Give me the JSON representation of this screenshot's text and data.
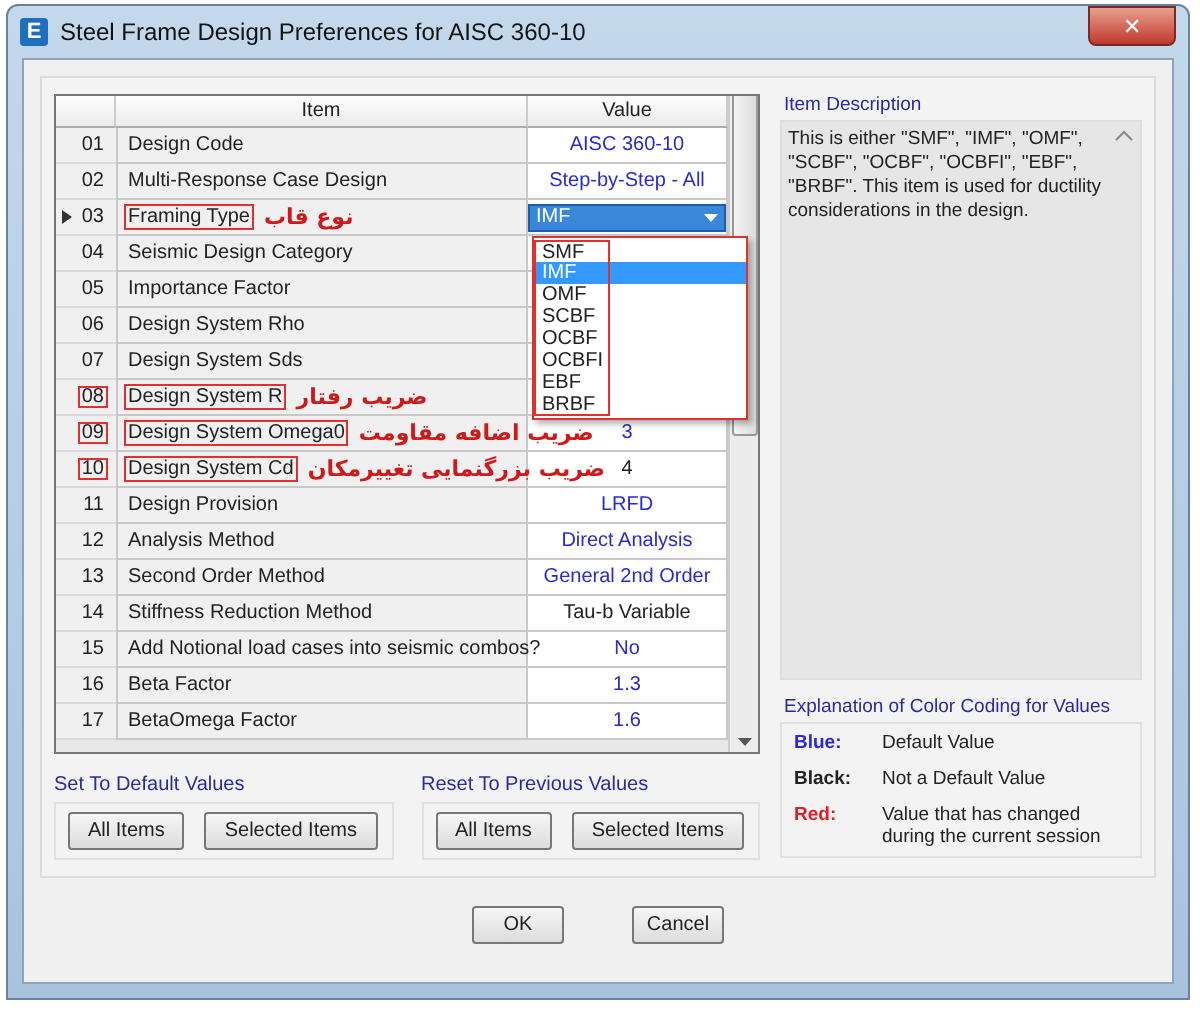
{
  "window": {
    "title": "Steel Frame Design Preferences for AISC 360-10",
    "icon_letter": "E",
    "close_label": "✕"
  },
  "grid": {
    "columns": [
      "Item",
      "Value"
    ],
    "rows": [
      {
        "number": "01",
        "item": "Design Code",
        "value": "AISC 360-10",
        "kind": "text",
        "color": "#2a2ad0",
        "current": false,
        "marked_number": false,
        "marked_item": false
      },
      {
        "number": "02",
        "item": "Multi-Response Case Design",
        "value": "Step-by-Step - All",
        "kind": "text",
        "color": "#2a2ad0",
        "current": false,
        "marked_number": false,
        "marked_item": false
      },
      {
        "number": "03",
        "item": "Framing Type",
        "value": "IMF",
        "kind": "combo",
        "current": true,
        "marked_number": false,
        "marked_item": true,
        "note": "نوع قاب"
      },
      {
        "number": "04",
        "item": "Seismic Design Category",
        "kind": "hidden",
        "current": false,
        "marked_number": false,
        "marked_item": false
      },
      {
        "number": "05",
        "item": "Importance Factor",
        "kind": "hidden",
        "current": false,
        "marked_number": false,
        "marked_item": false
      },
      {
        "number": "06",
        "item": "Design System Rho",
        "kind": "hidden",
        "current": false,
        "marked_number": false,
        "marked_item": false
      },
      {
        "number": "07",
        "item": "Design System Sds",
        "kind": "hidden",
        "current": false,
        "marked_number": false,
        "marked_item": false
      },
      {
        "number": "08",
        "item": "Design System R",
        "kind": "hidden",
        "current": false,
        "marked_number": true,
        "marked_item": true,
        "note": "ضریب رفتار"
      },
      {
        "number": "09",
        "item": "Design System Omega0",
        "value": "3",
        "kind": "text",
        "color": "#2a2ad0",
        "current": false,
        "marked_number": true,
        "marked_item": true,
        "note": "ضریب اضافه مقاومت"
      },
      {
        "number": "10",
        "item": "Design System Cd",
        "value": "4",
        "kind": "text",
        "color": "#222222",
        "current": false,
        "marked_number": true,
        "marked_item": true,
        "note": "ضریب بزرگنمایی تغییرمکان"
      },
      {
        "number": "11",
        "item": "Design Provision",
        "value": "LRFD",
        "kind": "text",
        "color": "#2a2ad0",
        "current": false,
        "marked_number": false,
        "marked_item": false
      },
      {
        "number": "12",
        "item": "Analysis Method",
        "value": "Direct Analysis",
        "kind": "text",
        "color": "#2a2ad0",
        "current": false,
        "marked_number": false,
        "marked_item": false
      },
      {
        "number": "13",
        "item": "Second Order Method",
        "value": "General 2nd Order",
        "kind": "text",
        "color": "#2a2ad0",
        "current": false,
        "marked_number": false,
        "marked_item": false
      },
      {
        "number": "14",
        "item": "Stiffness Reduction Method",
        "value": "Tau-b Variable",
        "kind": "text",
        "color": "#222222",
        "current": false,
        "marked_number": false,
        "marked_item": false
      },
      {
        "number": "15",
        "item": "Add Notional load cases into seismic combos?",
        "value": "No",
        "kind": "text",
        "color": "#2a2ad0",
        "current": false,
        "marked_number": false,
        "marked_item": false
      },
      {
        "number": "16",
        "item": "Beta Factor",
        "value": "1.3",
        "kind": "text",
        "color": "#2a2ad0",
        "current": false,
        "marked_number": false,
        "marked_item": false
      },
      {
        "number": "17",
        "item": "BetaOmega Factor",
        "value": "1.6",
        "kind": "text",
        "color": "#2a2ad0",
        "current": false,
        "marked_number": false,
        "marked_item": false
      }
    ],
    "dropdown": {
      "marked": true,
      "options": [
        {
          "label": "SMF",
          "selected": false
        },
        {
          "label": "IMF",
          "selected": true
        },
        {
          "label": "OMF",
          "selected": false
        },
        {
          "label": "SCBF",
          "selected": false
        },
        {
          "label": "OCBF",
          "selected": false
        },
        {
          "label": "OCBFI",
          "selected": false
        },
        {
          "label": "EBF",
          "selected": false
        },
        {
          "label": "BRBF",
          "selected": false
        }
      ]
    }
  },
  "item_description": {
    "title": "Item Description",
    "text": "This is either \"SMF\", \"IMF\", \"OMF\", \"SCBF\", \"OCBF\", \"OCBFI\", \"EBF\", \"BRBF\".  This item is used for ductility considerations in the design."
  },
  "color_legend": {
    "title": "Explanation of Color Coding for Values",
    "items": [
      {
        "label": "Blue:",
        "text": "Default Value",
        "color": "#2a2ad0"
      },
      {
        "label": "Black:",
        "text": "Not a Default Value",
        "color": "#222222"
      },
      {
        "label": "Red:",
        "text": "Value that has changed during the current session",
        "color": "#e02020"
      }
    ]
  },
  "button_groups": [
    {
      "title": "Set To Default Values",
      "buttons": [
        "All Items",
        "Selected Items"
      ]
    },
    {
      "title": "Reset To Previous Values",
      "buttons": [
        "All Items",
        "Selected Items"
      ]
    }
  ],
  "dialog_buttons": [
    "OK",
    "Cancel"
  ]
}
